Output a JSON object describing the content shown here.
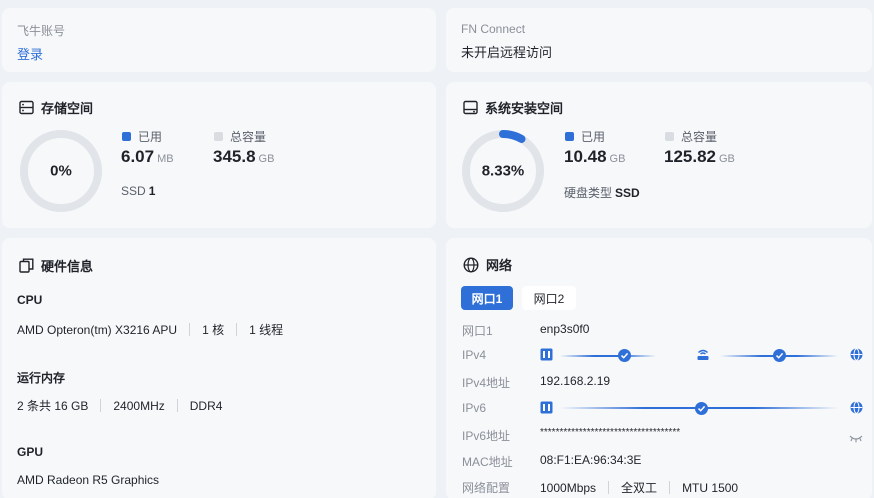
{
  "account": {
    "label": "飞牛账号",
    "action": "登录"
  },
  "fn_connect": {
    "label": "FN Connect",
    "status": "未开启远程访问"
  },
  "storage": {
    "title": "存储空间",
    "icon": "storage-icon",
    "percent_text": "0%",
    "percent": 0,
    "used_label": "已用",
    "used_value": "6.07",
    "used_unit": "MB",
    "total_label": "总容量",
    "total_value": "345.8",
    "total_unit": "GB",
    "disk_label": "SSD",
    "disk_count": "1"
  },
  "system": {
    "title": "系统安装空间",
    "icon": "hard-drive-icon",
    "percent_text": "8.33%",
    "percent": 8.33,
    "used_label": "已用",
    "used_value": "10.48",
    "used_unit": "GB",
    "total_label": "总容量",
    "total_value": "125.82",
    "total_unit": "GB",
    "disk_type_label": "硬盘类型",
    "disk_type": "SSD"
  },
  "hardware": {
    "title": "硬件信息",
    "icon": "copy-icon",
    "cpu": {
      "heading": "CPU",
      "model": "AMD Opteron(tm) X3216 APU",
      "cores": "1 核",
      "threads": "1 线程"
    },
    "memory": {
      "heading": "运行内存",
      "size": "2 条共 16 GB",
      "speed": "2400MHz",
      "type": "DDR4"
    },
    "gpu": {
      "heading": "GPU",
      "model": "AMD Radeon R5 Graphics"
    }
  },
  "network": {
    "title": "网络",
    "icon": "globe-icon",
    "tabs": [
      {
        "label": "网口1",
        "active": true
      },
      {
        "label": "网口2",
        "active": false
      }
    ],
    "rows": {
      "port_label": "网口1",
      "port_value": "enp3s0f0",
      "ipv4_label": "IPv4",
      "ipv4_addr_label": "IPv4地址",
      "ipv4_addr_value": "192.168.2.19",
      "ipv6_label": "IPv6",
      "ipv6_addr_label": "IPv6地址",
      "ipv6_addr_value": "************************************",
      "mac_label": "MAC地址",
      "mac_value": "08:F1:EA:96:34:3E",
      "config_label": "网络配置",
      "config_speed": "1000Mbps",
      "config_duplex": "全双工",
      "config_mtu": "MTU 1500"
    }
  },
  "colors": {
    "accent": "#2f6fd8",
    "ring_track": "#e1e4e9",
    "card": "#f7f8fa",
    "page": "#eef1f5",
    "total_square": "#d9dce1"
  }
}
